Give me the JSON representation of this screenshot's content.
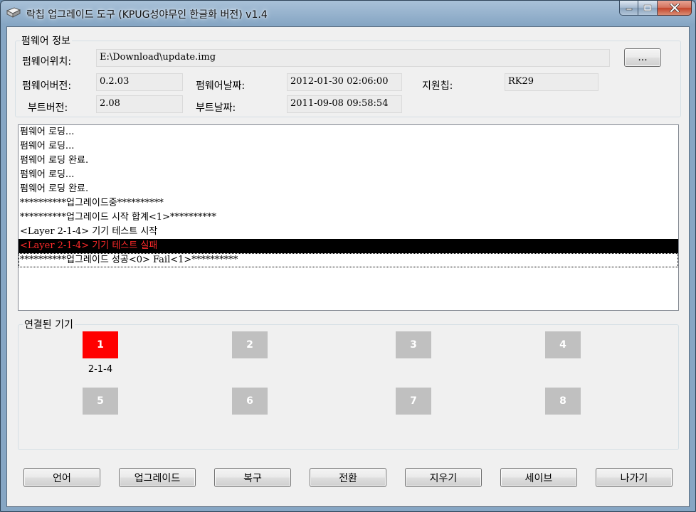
{
  "window": {
    "title": "락칩 업그레이드 도구 (KPUG성야무인 한글화 버전) v1.4"
  },
  "firmware_info": {
    "legend": "펌웨어 정보",
    "location_label": "펌웨어위치:",
    "location_value": "E:\\Download\\update.img",
    "browse_label": "...",
    "fw_version_label": "펌웨어버전:",
    "fw_version_value": "0.2.03",
    "fw_date_label": "펌웨어날짜:",
    "fw_date_value": "2012-01-30 02:06:00",
    "chip_label": "지원칩:",
    "chip_value": "RK29",
    "boot_version_label": "부트버전:",
    "boot_version_value": "2.08",
    "boot_date_label": "부트날짜:",
    "boot_date_value": "2011-09-08 09:58:54"
  },
  "log": [
    "펌웨어 로딩...",
    "펌웨어 로딩...",
    "펌웨어 로딩 완료.",
    "펌웨어 로딩...",
    "펌웨어 로딩 완료.",
    "**********업그레이드중**********",
    "**********업그레이드 시작 합계<1>**********",
    "<Layer 2-1-4> 기기 테스트 시작",
    "<Layer 2-1-4> 기기 테스트 실패",
    "**********업그레이드 성공<0> Fail<1>**********"
  ],
  "devices": {
    "legend": "연결된 기기",
    "slots": [
      "1",
      "2",
      "3",
      "4",
      "5",
      "6",
      "7",
      "8"
    ],
    "active_slot": "1",
    "active_layer": "2-1-4",
    "active_color": "#ff0000",
    "idle_color": "#c0c0c0"
  },
  "buttons": {
    "language": "언어",
    "upgrade": "업그레이드",
    "restore": "복구",
    "switch": "전환",
    "clear": "지우기",
    "save": "세이브",
    "exit": "나가기"
  }
}
